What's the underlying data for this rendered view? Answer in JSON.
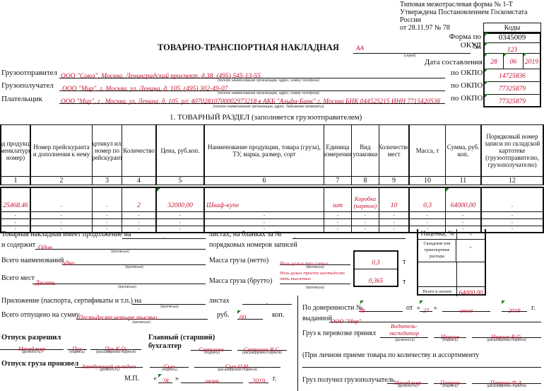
{
  "header": {
    "form_type": "Типовая межотраслевая форма № 1-Т",
    "approved": "Утверждена Постановлением Госкомстата России",
    "approved_date": "от 28.11.97 № 78",
    "title": "ТОВАРНО-ТРАНСПОРТНАЯ НАКЛАДНАЯ",
    "series_value": "АА",
    "series_caption": "(серия)",
    "codes_label": "Коды",
    "okud_label": "Форма по ОКУД",
    "okud_value": "0345009",
    "number_label": "№",
    "number_value": "123",
    "date_label": "Дата составления",
    "date_day": "28",
    "date_month": "06",
    "date_year": "2019",
    "okpo_label": "по ОКПО"
  },
  "parties": [
    {
      "label": "Грузоотправител",
      "value": "ООО \"Союз\", Москва, Ленинградский проспект, д.38, (495) 545-13-55",
      "caption": "(полное наименование организации, адрес, номер телефона)",
      "okpo": "14725836"
    },
    {
      "label": "Грузополучател",
      "value": "ООО \"Мир\", г. Москва, ул. Ленина, д. 105, (495) 302-49-07",
      "caption": "(полное наименование организации, адрес, номер телефона)",
      "okpo": "77325879"
    },
    {
      "label": "Плательщик",
      "value": "ООО \"Мир\", г . Москва, ул. Ленина, д. 105, р/с 40702810700002973218 в АКБ \"Альфа-Банк\" г. Москва БИК 044525215 ИНН 7715420538",
      "caption": "(полное наименование организации, адрес, банковские реквизиты)",
      "okpo": "77325879"
    }
  ],
  "section": {
    "title": "1. ТОВАРНЫЙ РАЗДЕЛ (заполняется грузоотправителем)",
    "columns": [
      "Код продукции (номенклатурный номер)",
      "Номер прейскуранта и дополнения к нему",
      "Артикул или номер по прейскуранту",
      "Количество",
      "Цена, руб.коп.",
      "Наименование продукции, товара (груза), ТУ, марка, размер, сорт",
      "Единица измерения",
      "Вид упаковки",
      "Количество мест",
      "Масса, т",
      "Сумма, руб. коп.",
      "Порядковый номер записи по складской картотеке (грузоотправителю, грузополучателю)"
    ],
    "column_numbers": [
      "1",
      "2",
      "3",
      "4",
      "5",
      "6",
      "7",
      "8",
      "9",
      "10",
      "11",
      "12"
    ],
    "rows": [
      [
        "25468.46",
        "-",
        "-",
        "2",
        "32000,00",
        "Шкаф-купе",
        "шт",
        "Коробка (картон)",
        "10",
        "0,3",
        "64000,00",
        "-"
      ],
      [
        "-",
        "-",
        "-",
        "-",
        "-",
        "-",
        "-",
        "-",
        "-",
        "-",
        "-",
        "-"
      ],
      [
        "-",
        "-",
        "-",
        "-",
        "-",
        "-",
        "-",
        "-",
        "-",
        "-",
        "-",
        "-"
      ],
      [
        "-",
        "-",
        "-",
        "-",
        "-",
        "-",
        "-",
        "-",
        "-",
        "-",
        "-",
        "-"
      ]
    ]
  },
  "summary": {
    "continuation_label": "Товарная накладная имеет продолжение на",
    "continuation_value": "-",
    "sheets_label": "листах, на бланках за №",
    "sheets_value": "-",
    "contains_label": "и содержит",
    "contains_value": "Один",
    "records_label": "порядковых номеров записей",
    "caption_words": "(прописью)",
    "total_names_label": "Всего наименований",
    "total_names_value": "одно",
    "total_places_label": "Всего мест",
    "total_places_value": "Десять",
    "net_label": "Масса груза (нетто)",
    "net_words": "Ноль целых три сотых",
    "net_value": "0,3",
    "gross_label": "Масса груза (брутто)",
    "gross_words": "Ноль целых триста шестьдесят пять тысячных",
    "gross_value": "0,365",
    "unit_t": "т",
    "attachment_label": "Приложение (паспорта, сертификаты и т.п.) на",
    "attachment_value": "-",
    "attachment_sheets": "листах",
    "attachment_sheets_value": "-",
    "released_sum_label": "Всего отпущено на сумму",
    "released_sum_value": "Шестьдесят четыре тысячи",
    "rub": "руб.",
    "kop_value": "00",
    "kop": "коп."
  },
  "totals_box": {
    "markup_label": "Наценка, %",
    "markup_value": "-",
    "warehouse_label": "Складские или транспортные расходы",
    "warehouse_value": "-",
    "total_label": "Всего к оплате",
    "total_value": "64000,00"
  },
  "signatures": {
    "release_allowed_label": "Отпуск разрешил",
    "release_allowed_position": "Менеджер",
    "release_allowed_sign": "Пух",
    "release_allowed_name": "Пух К.О.",
    "chief_label_1": "Главный (старший)",
    "chief_label_2": "бухгалтер",
    "chief_sign": "Светлова",
    "chief_name": "Светлова В.С.",
    "released_by_label": "Отпуск груза произвел",
    "released_by_position": "Заведующий складом",
    "released_by_sign": "Сыч",
    "released_by_name": "Сыч О.Н.",
    "cap_position": "(должность)",
    "cap_sign": "(подпись)",
    "cap_name": "(расшифровка подписи)",
    "mp": "М.П.",
    "date_day": "28",
    "date_month": "июня",
    "date_year": "2019",
    "year_suffix": "г."
  },
  "proxy": {
    "label": "По доверенности №",
    "number": "48",
    "from_label": "от",
    "day": "27",
    "month": "июня",
    "year": "2019",
    "year_suffix": "г.",
    "issued_label": "выданной",
    "issued_value": "ООО \"Мир\"",
    "accepted_label": "Груз к перевозке принял",
    "accepted_position": "Водитель-экспедитор",
    "accepted_sign": "Иванов",
    "accepted_name": "Иванов В.О.",
    "personal_note": "(При личном приеме товара по количеству и ассортименту",
    "received_label": "Груз получил грузополучатель",
    "received_position": "Менеджер",
    "received_sign": "Петров",
    "received_name": "Петров Ф.А."
  }
}
